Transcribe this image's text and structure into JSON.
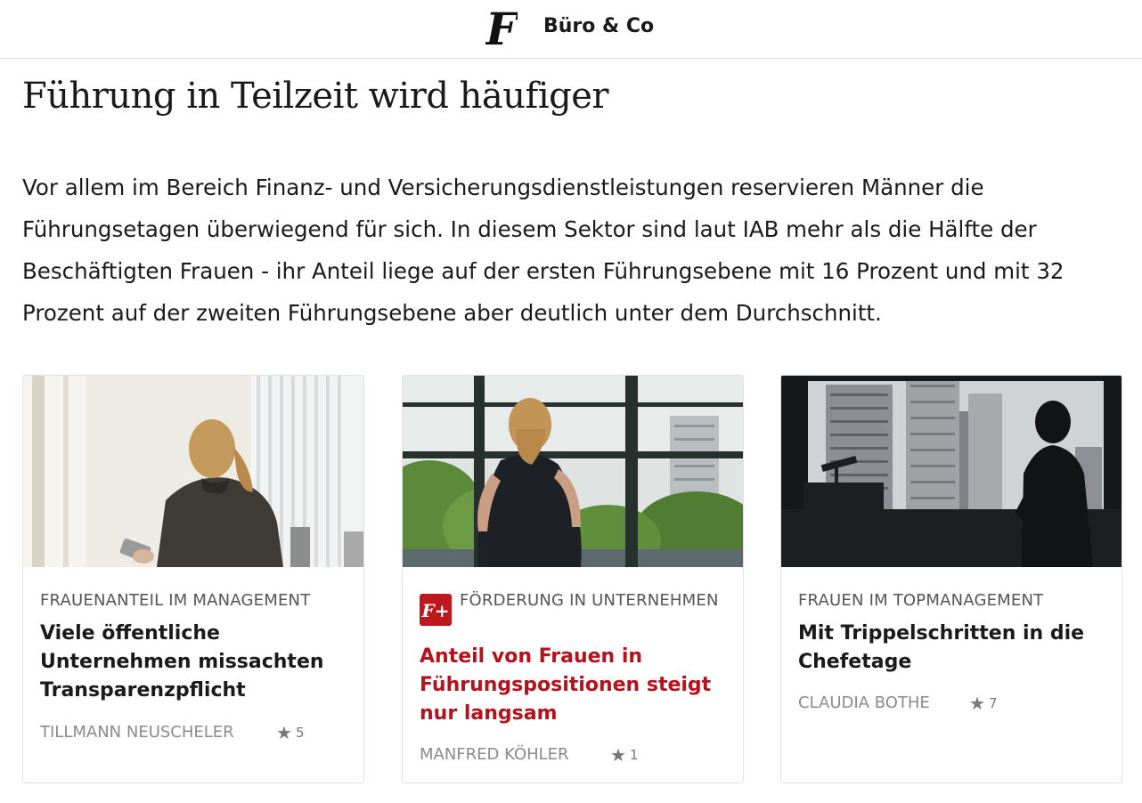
{
  "header": {
    "logo_letter": "F",
    "section_name": "Büro & Co"
  },
  "article": {
    "headline": "Führung in Teilzeit wird häufiger",
    "lede": "Vor allem im Bereich Finanz- und Versicherungsdienstleistungen reservieren Männer die Führungsetagen überwiegend für sich. In diesem Sektor sind laut IAB mehr als die Hälfte der Beschäftigten Frauen - ihr Anteil liege auf der ersten Führungsebene mit 16 Prozent und mit 32 Prozent auf der zweiten Führungsebene aber deutlich unter dem Durchschnitt."
  },
  "cards": [
    {
      "kicker": "FRAUENANTEIL IM MANAGEMENT",
      "title": "Viele öffentliche Unternehmen missachten Transparenzpflicht",
      "author": "TILLMANN NEUSCHELER",
      "rating": "5",
      "premium": false,
      "image_icon": "photo-woman-with-phone-icon"
    },
    {
      "kicker": "FÖRDERUNG IN UNTERNEHMEN",
      "title": "Anteil von Frauen in Führungspositionen steigt nur langsam",
      "author": "MANFRED KÖHLER",
      "rating": "1",
      "premium": true,
      "badge_text": "F+",
      "image_icon": "photo-woman-at-window-icon"
    },
    {
      "kicker": "FRAUEN IM TOPMANAGEMENT",
      "title": "Mit Trippelschritten in die Chefetage",
      "author": "CLAUDIA BOTHE",
      "rating": "7",
      "premium": false,
      "image_icon": "photo-skyline-silhouette-icon"
    }
  ],
  "colors": {
    "premium_red": "#b5121b",
    "badge_red": "#c0161d",
    "meta_gray": "#8a8a8a"
  }
}
